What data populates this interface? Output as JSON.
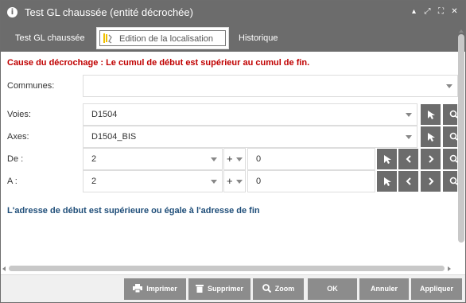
{
  "window": {
    "title": "Test GL chaussée (entité décrochée)",
    "controls": [
      "minimize-icon",
      "maximize-icon",
      "fullscreen-icon",
      "close-icon"
    ]
  },
  "tabs": [
    {
      "label": "Test GL chaussée",
      "selected": false
    },
    {
      "label": "Edition de la localisation",
      "selected": true,
      "icon": "map-ruler-icon"
    },
    {
      "label": "Historique",
      "selected": false
    }
  ],
  "error_message": "Cause du décrochage : Le cumul de début est supérieur au cumul de fin.",
  "form": {
    "communes": {
      "label": "Communes:",
      "value": ""
    },
    "voies": {
      "label": "Voies:",
      "value": "D1504"
    },
    "axes": {
      "label": "Axes:",
      "value": "D1504_BIS"
    },
    "de": {
      "label": "De :",
      "value": "2",
      "sign": "+",
      "offset": "0"
    },
    "a": {
      "label": "A :",
      "value": "2",
      "sign": "+",
      "offset": "0"
    }
  },
  "info_message": "L'adresse de début est supérieure ou égale à l'adresse de fin",
  "footer": {
    "imprimer": "Imprimer",
    "supprimer": "Supprimer",
    "zoom": "Zoom",
    "ok": "OK",
    "annuler": "Annuler",
    "appliquer": "Appliquer"
  },
  "colors": {
    "titlebar": "#6c6c6c",
    "error": "#c00000",
    "info": "#1f4e79",
    "button": "#8c8c8c"
  }
}
